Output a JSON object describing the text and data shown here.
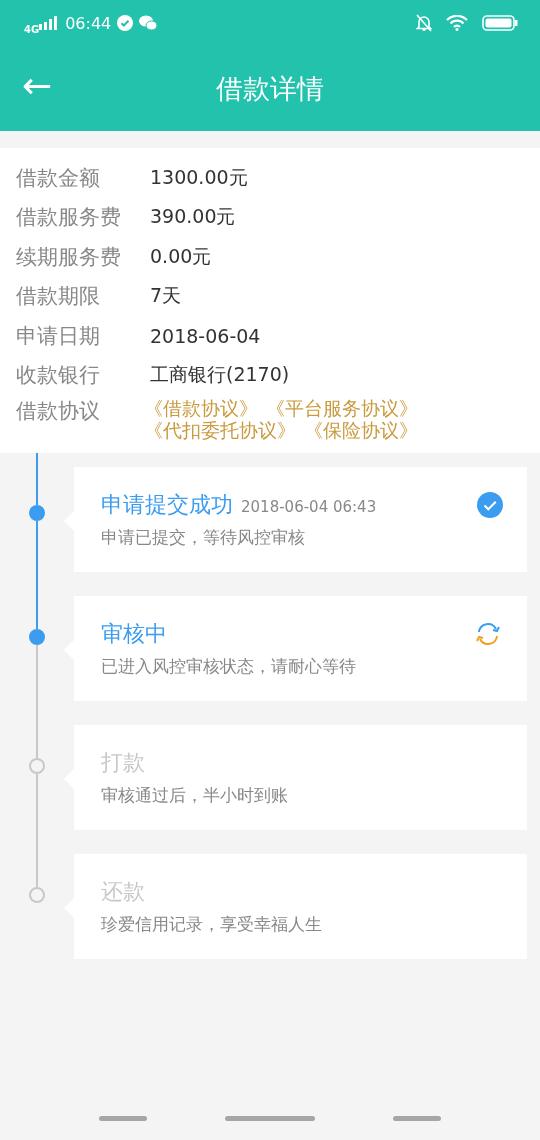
{
  "status_bar": {
    "network": "4G",
    "time": "06:44"
  },
  "header": {
    "back": "←",
    "title": "借款详情"
  },
  "details": [
    {
      "label": "借款金额",
      "value": "1300.00元"
    },
    {
      "label": "借款服务费",
      "value": "390.00元"
    },
    {
      "label": "续期服务费",
      "value": "0.00元"
    },
    {
      "label": "借款期限",
      "value": "7天"
    },
    {
      "label": "申请日期",
      "value": "2018-06-04"
    },
    {
      "label": "收款银行",
      "value": "工商银行(2170)"
    }
  ],
  "agreements": {
    "label": "借款协议",
    "links": [
      "《借款协议》",
      "《平台服务协议》",
      "《代扣委托协议》",
      "《保险协议》"
    ]
  },
  "steps": [
    {
      "kind": "done",
      "title": "申请提交成功",
      "time": "2018-06-04 06:43",
      "desc": "申请已提交，等待风控审核"
    },
    {
      "kind": "active",
      "title": "审核中",
      "desc": "已进入风控审核状态，请耐心等待"
    },
    {
      "kind": "pending",
      "title": "打款",
      "desc": "审核通过后，半小时到账"
    },
    {
      "kind": "pending",
      "title": "还款",
      "desc": "珍爱信用记录，享受幸福人生"
    }
  ]
}
